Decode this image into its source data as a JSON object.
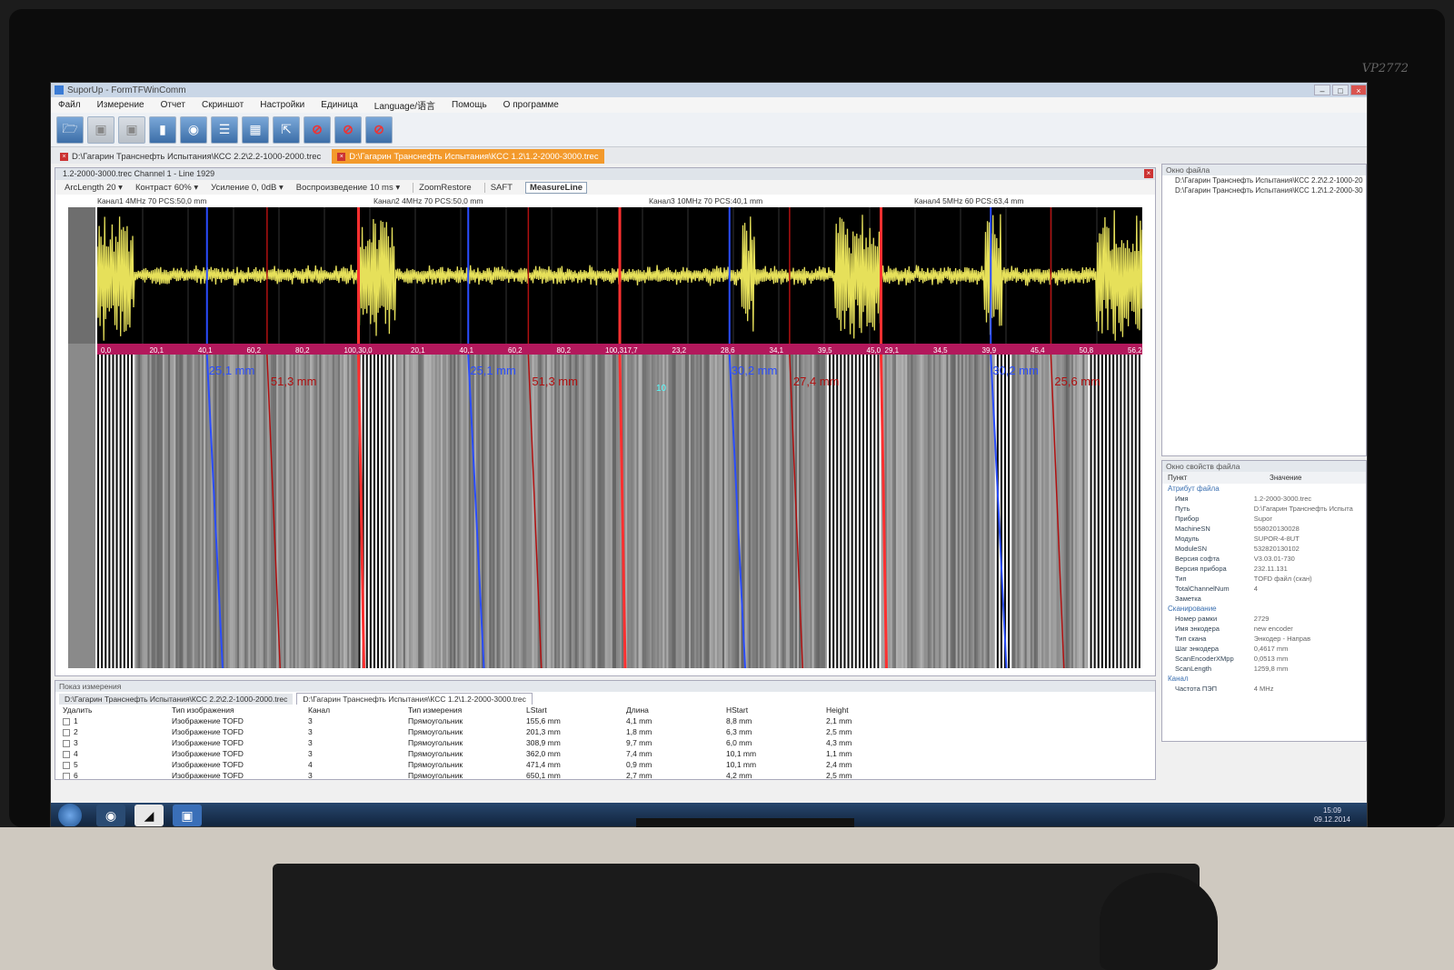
{
  "monitor": {
    "brand": "VP2772"
  },
  "window": {
    "title": "SuporUp - FormTFWinComm",
    "controls": [
      "–",
      "□",
      "×"
    ]
  },
  "menu": [
    "Файл",
    "Измерение",
    "Отчет",
    "Скриншот",
    "Настройки",
    "Единица",
    "Language/语言",
    "Помощь",
    "О программе"
  ],
  "toolbar": {
    "buttons": [
      "folder-open-icon",
      "save-icon",
      "save-as-icon",
      "export-icon",
      "camera-icon",
      "report-icon",
      "image-icon",
      "cursor-icon",
      "cancel-icon",
      "cancel-icon",
      "cancel-grid-icon"
    ]
  },
  "doc_tabs": [
    {
      "label": "D:\\Гагарин Транснефть Испытания\\КСС 2.2\\2.2-1000-2000.trec",
      "active": false
    },
    {
      "label": "D:\\Гагарин Транснефть Испытания\\КСС 1.2\\1.2-2000-3000.trec",
      "active": true
    }
  ],
  "scan_window": {
    "title": "1.2-2000-3000.trec Channel 1 - Line 1929",
    "arclength_label": "ArcLength",
    "arclength_value": "20",
    "contrast_label": "Контраст",
    "contrast_value": "60%",
    "gain_label": "Усиление",
    "gain_value": "0, 0dB",
    "playback_label": "Воспроизведение",
    "playback_value": "10 ms",
    "zoom_restore": "ZoomRestore",
    "saft": "SAFT",
    "measure_line": "MeasureLine"
  },
  "channels": [
    {
      "label": "Канал1  4MHz  70  PCS:50,0 mm",
      "ticks": [
        "0,0",
        "20,1",
        "40,1",
        "60,2",
        "80,2",
        "100,3"
      ],
      "blue_label": "25,1 mm",
      "red_label": "51,3 mm",
      "extra_label": ""
    },
    {
      "label": "Канал2  4MHz  70  PCS:50,0 mm",
      "ticks": [
        "0,0",
        "20,1",
        "40,1",
        "60,2",
        "80,2",
        "100,3"
      ],
      "blue_label": "25,1 mm",
      "red_label": "51,3 mm",
      "extra_label": ""
    },
    {
      "label": "Канал3  10MHz  70  PCS:40,1 mm",
      "ticks": [
        "17,7",
        "23,2",
        "28,6",
        "34,1",
        "39,5",
        "45,0"
      ],
      "blue_label": "30,2 mm",
      "red_label": "27,4 mm",
      "extra_label": "10"
    },
    {
      "label": "Канал4  5MHz  60  PCS:63,4 mm",
      "ticks": [
        "29,1",
        "34,5",
        "39,9",
        "45,4",
        "50,8",
        "56,2"
      ],
      "blue_label": "30,2 mm",
      "red_label": "25,6 mm",
      "extra_label": ""
    }
  ],
  "file_window": {
    "title": "Окно файла",
    "entries": [
      "D:\\Гагарин Транснефть Испытания\\КСС 2.2\\2.2-1000-20",
      "D:\\Гагарин Транснефть Испытания\\КСС 1.2\\1.2-2000-30"
    ]
  },
  "props_window": {
    "title": "Окно свойств файла",
    "col_key": "Пункт",
    "col_value": "Значение",
    "group_file": "Атрибут файла",
    "rows": [
      [
        "Имя",
        "1.2-2000-3000.trec"
      ],
      [
        "Путь",
        "D:\\Гагарин Транснефть Испыта"
      ],
      [
        "Прибор",
        "Supor"
      ],
      [
        "MachineSN",
        "558020130028"
      ],
      [
        "Модуль",
        "SUPOR-4-8UT"
      ],
      [
        "ModuleSN",
        "532820130102"
      ],
      [
        "Версия софта",
        "V3.03.01-730"
      ],
      [
        "Версия прибора",
        "232.11.131"
      ],
      [
        "Тип",
        "TOFD файл (скан)"
      ],
      [
        "TotalChannelNum",
        "4"
      ],
      [
        "Заметка",
        ""
      ]
    ],
    "group_scan": "Сканирование",
    "scan_rows": [
      [
        "Номер рамки",
        "2729"
      ],
      [
        "Имя энкодера",
        "new encoder"
      ],
      [
        "Тип скана",
        "Энкодер - Направ"
      ],
      [
        "Шаг энкодера",
        "0,4617 mm"
      ],
      [
        "ScanEncoderXMpp",
        "0,0513 mm"
      ],
      [
        "ScanLength",
        "1259,8 mm"
      ]
    ],
    "group_channel": "Канал",
    "channel_rows": [
      [
        "Частота ПЭП",
        "4 MHz"
      ]
    ]
  },
  "measurements": {
    "panel_title": "Показ измерения",
    "tabs": [
      {
        "label": "D:\\Гагарин Транснефть Испытания\\КСС 2.2\\2.2-1000-2000.trec",
        "active": false
      },
      {
        "label": "D:\\Гагарин Транснефть Испытания\\КСС 1.2\\1.2-2000-3000.trec",
        "active": true
      }
    ],
    "columns": [
      "Удалить",
      "Тип изображения",
      "Канал",
      "Тип измерения",
      "LStart",
      "Длина",
      "HStart",
      "Height"
    ],
    "rows": [
      [
        "1",
        "Изображение TOFD",
        "3",
        "Прямоугольник",
        "155,6 mm",
        "4,1 mm",
        "8,8 mm",
        "2,1 mm"
      ],
      [
        "2",
        "Изображение TOFD",
        "3",
        "Прямоугольник",
        "201,3 mm",
        "1,8 mm",
        "6,3 mm",
        "2,5 mm"
      ],
      [
        "3",
        "Изображение TOFD",
        "3",
        "Прямоугольник",
        "308,9 mm",
        "9,7 mm",
        "6,0 mm",
        "4,3 mm"
      ],
      [
        "4",
        "Изображение TOFD",
        "3",
        "Прямоугольник",
        "362,0 mm",
        "7,4 mm",
        "10,1 mm",
        "1,1 mm"
      ],
      [
        "5",
        "Изображение TOFD",
        "4",
        "Прямоугольник",
        "471,4 mm",
        "0,9 mm",
        "10,1 mm",
        "2,4 mm"
      ],
      [
        "6",
        "Изображение TOFD",
        "3",
        "Прямоугольник",
        "650,1 mm",
        "2,7 mm",
        "4,2 mm",
        "2,5 mm"
      ]
    ]
  },
  "taskbar": {
    "apps": [
      "windows-start-icon",
      "chrome-icon",
      "suporup-icon",
      "save-disk-icon"
    ],
    "tray_time": "15:09",
    "tray_date": "09.12.2014"
  },
  "colors": {
    "accent_tab": "#f39a2c",
    "ruler": "#b3185c",
    "signal": "#e6e05a",
    "gate_red": "#ff3030",
    "cursor_blue": "#2a4dff",
    "cursor_red": "#b01010"
  }
}
